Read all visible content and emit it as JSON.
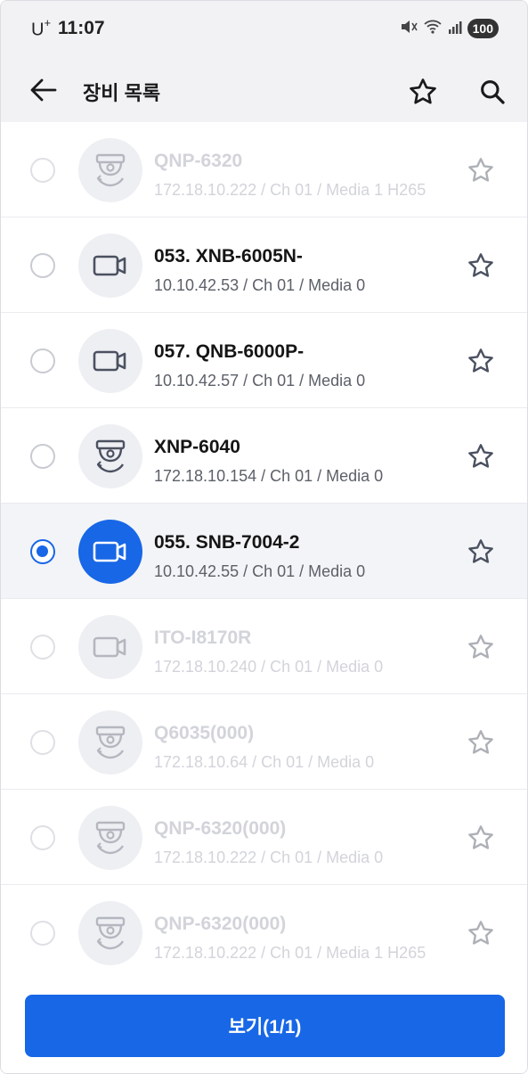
{
  "status_bar": {
    "carrier": "U",
    "carrier_plus": "+",
    "time": "11:07",
    "battery": "100"
  },
  "header": {
    "title": "장비 목록"
  },
  "devices": [
    {
      "name": "QNP-6320",
      "detail": "172.18.10.222 / Ch 01 / Media 1 H265",
      "icon": "dome-camera-icon",
      "dimmed": true,
      "selected": false
    },
    {
      "name": "053. XNB-6005N-",
      "detail": "10.10.42.53 / Ch 01 / Media 0",
      "icon": "box-camera-icon",
      "dimmed": false,
      "selected": false
    },
    {
      "name": "057. QNB-6000P-",
      "detail": "10.10.42.57 / Ch 01 / Media 0",
      "icon": "box-camera-icon",
      "dimmed": false,
      "selected": false
    },
    {
      "name": "XNP-6040",
      "detail": "172.18.10.154 / Ch 01 / Media 0",
      "icon": "dome-camera-icon",
      "dimmed": false,
      "selected": false
    },
    {
      "name": "055. SNB-7004-2",
      "detail": "10.10.42.55 / Ch 01 / Media 0",
      "icon": "box-camera-icon",
      "dimmed": false,
      "selected": true
    },
    {
      "name": "ITO-I8170R",
      "detail": "172.18.10.240 / Ch 01 / Media 0",
      "icon": "box-camera-icon",
      "dimmed": true,
      "selected": false
    },
    {
      "name": "Q6035(000)",
      "detail": "172.18.10.64 / Ch 01 / Media 0",
      "icon": "dome-camera-icon",
      "dimmed": true,
      "selected": false
    },
    {
      "name": "QNP-6320(000)",
      "detail": "172.18.10.222 / Ch 01 / Media 0",
      "icon": "dome-camera-icon",
      "dimmed": true,
      "selected": false
    },
    {
      "name": "QNP-6320(000)",
      "detail": "172.18.10.222 / Ch 01 / Media 1 H265",
      "icon": "dome-camera-icon",
      "dimmed": true,
      "selected": false
    }
  ],
  "footer": {
    "view_button": "보기(1/1)"
  },
  "colors": {
    "accent": "#1767e6",
    "header_bg": "#f2f2f5",
    "icon_gray": "#4b5160"
  }
}
